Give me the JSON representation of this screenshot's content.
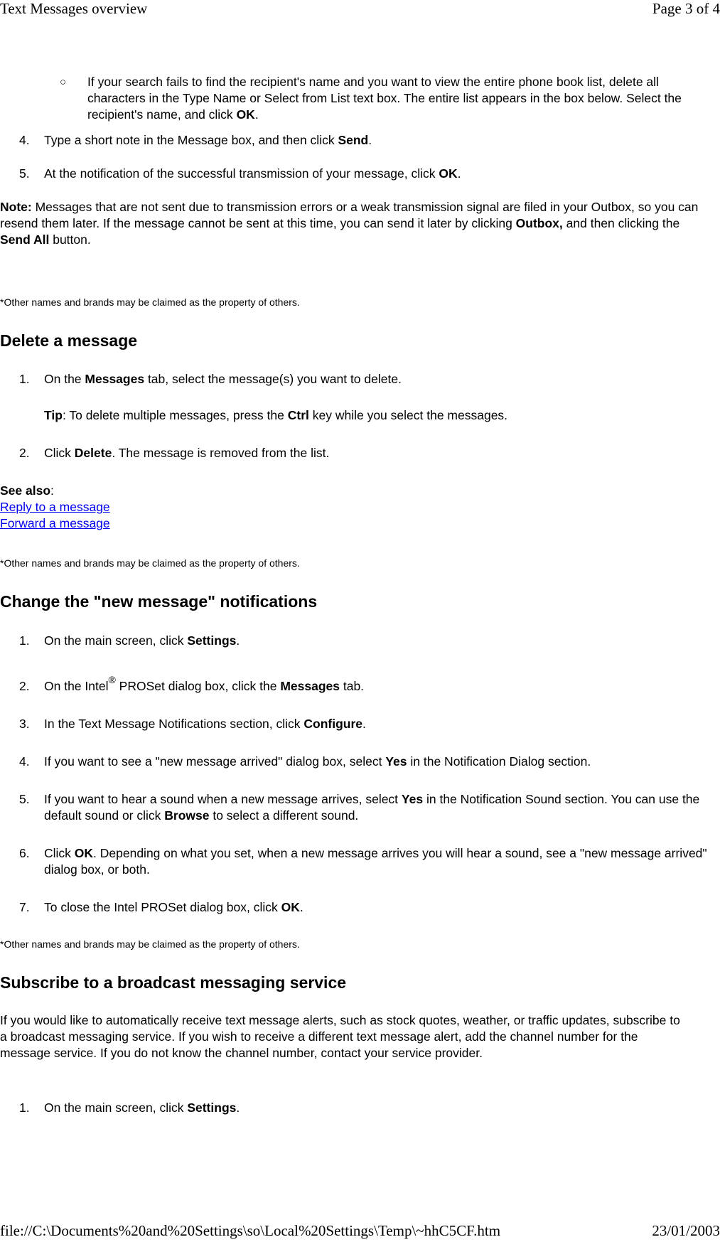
{
  "header": {
    "title": "Text Messages overview",
    "page": "Page 3 of 4"
  },
  "footer": {
    "path": "file://C:\\Documents%20and%20Settings\\so\\Local%20Settings\\Temp\\~hhC5CF.htm",
    "date": "23/01/2003"
  },
  "intro": {
    "sub_bullet": {
      "a": "If your search fails to find the recipient's name and you want to view the entire phone book list, delete all characters in the Type Name or Select from List text box. The entire list appears in the box below. Select the recipient's name, and click ",
      "b": "OK",
      "c": "."
    },
    "steps": [
      {
        "num": "4.",
        "a": "Type a short note in the Message box, and then click ",
        "b": "Send",
        "c": "."
      },
      {
        "num": "5.",
        "a": "At the notification of the successful transmission of your message, click ",
        "b": "OK",
        "c": "."
      }
    ],
    "note": {
      "label": "Note:",
      "a": " Messages that are not sent due to transmission errors or a weak transmission signal are filed in your Outbox, so you can resend them later. If the message cannot be sent at this time, you can send it later by clicking ",
      "b": "Outbox,",
      "c": " and then clicking the ",
      "d": "Send All",
      "e": " button."
    },
    "disclaimer": "*Other names and brands may be claimed as the property of others."
  },
  "delete": {
    "title": "Delete a message",
    "step1": {
      "num": "1.",
      "a": "On the ",
      "b": "Messages",
      "c": " tab, select the message(s) you want to delete."
    },
    "tip": {
      "label": "Tip",
      "a": ": To delete multiple messages, press the ",
      "b": "Ctrl",
      "c": " key while you select the messages."
    },
    "step2": {
      "num": "2.",
      "a": "Click ",
      "b": "Delete",
      "c": ". The message is removed from the list."
    },
    "see_also": {
      "label": "See also",
      "colon": ":",
      "links": [
        "Reply to a message",
        "Forward a message"
      ]
    },
    "disclaimer": "*Other names and brands may be claimed as the property of others."
  },
  "notifications": {
    "title": "Change the \"new message\" notifications",
    "steps": [
      {
        "num": "1.",
        "a": "On the main screen, click ",
        "b": "Settings",
        "c": "."
      },
      {
        "num": "2.",
        "a": "On the Intel",
        "sup": "®",
        "a2": " PROSet dialog box, click the ",
        "b": "Messages",
        "c": " tab."
      },
      {
        "num": "3.",
        "a": "In the Text Message Notifications section, click ",
        "b": "Configure",
        "c": "."
      },
      {
        "num": "4.",
        "a": "If you want to see a \"new message arrived\" dialog box, select ",
        "b": "Yes",
        "c": " in the Notification Dialog section."
      },
      {
        "num": "5.",
        "a": "If you want to hear a sound when a new message arrives, select ",
        "b": "Yes",
        "c": " in the Notification Sound section. You can use the default sound or click ",
        "d": "Browse",
        "e": " to select a different sound."
      },
      {
        "num": "6.",
        "a": "Click ",
        "b": "OK",
        "c": ". Depending on what you set, when a new message arrives you will hear a sound, see a \"new message arrived\" dialog box, or both."
      },
      {
        "num": "7.",
        "a": "To close the Intel PROSet dialog box, click ",
        "b": "OK",
        "c": "."
      }
    ],
    "disclaimer": "*Other names and brands may be claimed as the property of others."
  },
  "broadcast": {
    "title": "Subscribe to a broadcast messaging service",
    "intro": "If you would like to automatically receive text message alerts, such as stock quotes, weather, or traffic updates, subscribe to a broadcast messaging service. If you wish to receive a different text message alert, add the channel number for the message service. If you do not know the channel number, contact your service provider.",
    "step1": {
      "num": "1.",
      "a": "On the main screen, click ",
      "b": "Settings",
      "c": "."
    }
  }
}
